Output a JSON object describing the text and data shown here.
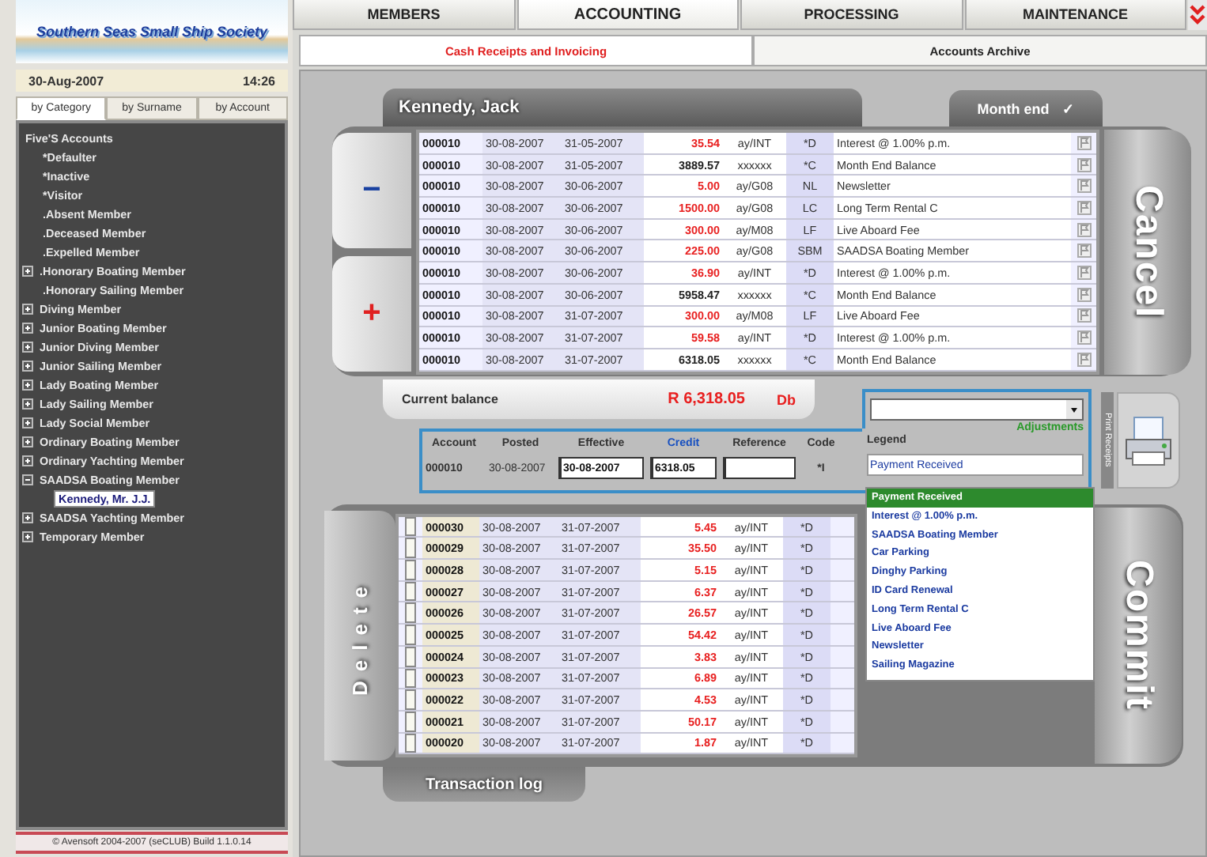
{
  "sidebar": {
    "logo": "Southern Seas Small Ship Society",
    "date": "30-Aug-2007",
    "time": "14:26",
    "tabs": [
      {
        "label": "by Category",
        "selected": true
      },
      {
        "label": "by Surname",
        "selected": false
      },
      {
        "label": "by Account",
        "selected": false
      }
    ],
    "tree": {
      "label": "Five'S Accounts",
      "children": [
        {
          "label": "*Defaulter",
          "kind": "leaf",
          "selected": false
        },
        {
          "label": "*Inactive",
          "kind": "leaf",
          "selected": false
        },
        {
          "label": "*Visitor",
          "kind": "leaf",
          "selected": false
        },
        {
          "label": ".Absent Member",
          "kind": "leaf",
          "selected": false
        },
        {
          "label": ".Deceased Member",
          "kind": "leaf",
          "selected": false
        },
        {
          "label": ".Expelled Member",
          "kind": "leaf",
          "selected": false
        },
        {
          "label": ".Honorary Boating Member",
          "kind": "group",
          "expanded": false,
          "selected": false
        },
        {
          "label": ".Honorary Sailing Member",
          "kind": "leaf",
          "selected": false
        },
        {
          "label": "Diving Member",
          "kind": "group",
          "expanded": false,
          "selected": false
        },
        {
          "label": "Junior Boating Member",
          "kind": "group",
          "expanded": false,
          "selected": false
        },
        {
          "label": "Junior Diving Member",
          "kind": "group",
          "expanded": false,
          "selected": false
        },
        {
          "label": "Junior Sailing Member",
          "kind": "group",
          "expanded": false,
          "selected": false
        },
        {
          "label": "Lady Boating Member",
          "kind": "group",
          "expanded": false,
          "selected": false
        },
        {
          "label": "Lady Sailing Member",
          "kind": "group",
          "expanded": false,
          "selected": false
        },
        {
          "label": "Lady Social Member",
          "kind": "group",
          "expanded": false,
          "selected": false
        },
        {
          "label": "Ordinary Boating Member",
          "kind": "group",
          "expanded": false,
          "selected": false
        },
        {
          "label": "Ordinary Yachting Member",
          "kind": "group",
          "expanded": false,
          "selected": false
        },
        {
          "label": "SAADSA Boating Member",
          "kind": "group",
          "expanded": true,
          "selected": false,
          "children": [
            {
              "label": "Kennedy, Mr. J.J.",
              "kind": "leaf",
              "selected": true
            }
          ]
        },
        {
          "label": "SAADSA Yachting Member",
          "kind": "group",
          "expanded": false,
          "selected": false
        },
        {
          "label": "Temporary Member",
          "kind": "group",
          "expanded": false,
          "selected": false
        }
      ]
    },
    "footer": "© Avensoft 2004-2007 (seCLUB) Build 1.1.0.14"
  },
  "tabs": [
    {
      "label": "MEMBERS",
      "selected": false
    },
    {
      "label": "ACCOUNTING",
      "selected": true
    },
    {
      "label": "PROCESSING",
      "selected": false
    },
    {
      "label": "MAINTENANCE",
      "selected": false
    }
  ],
  "subtabs": [
    {
      "label": "Cash Receipts and Invoicing",
      "selected": true
    },
    {
      "label": "Accounts Archive",
      "selected": false
    }
  ],
  "member_name": "Kennedy, Jack",
  "month_end": {
    "label": "Month end",
    "mark": "✓"
  },
  "ledger": {
    "minus": "−",
    "plus": "+",
    "cancel": "Cancel",
    "rows": [
      {
        "account": "000010",
        "posted": "30-08-2007",
        "effective": "31-05-2007",
        "amount": "35.54",
        "debit": true,
        "ref": "ay/INT",
        "code": "*D",
        "legend": "Interest @ 1.00% p.m."
      },
      {
        "account": "000010",
        "posted": "30-08-2007",
        "effective": "31-05-2007",
        "amount": "3889.57",
        "debit": false,
        "ref": "xxxxxx",
        "code": "*C",
        "legend": "Month End Balance"
      },
      {
        "account": "000010",
        "posted": "30-08-2007",
        "effective": "30-06-2007",
        "amount": "5.00",
        "debit": true,
        "ref": "ay/G08",
        "code": "NL",
        "legend": "Newsletter"
      },
      {
        "account": "000010",
        "posted": "30-08-2007",
        "effective": "30-06-2007",
        "amount": "1500.00",
        "debit": true,
        "ref": "ay/G08",
        "code": "LC",
        "legend": "Long Term Rental C"
      },
      {
        "account": "000010",
        "posted": "30-08-2007",
        "effective": "30-06-2007",
        "amount": "300.00",
        "debit": true,
        "ref": "ay/M08",
        "code": "LF",
        "legend": "Live Aboard Fee"
      },
      {
        "account": "000010",
        "posted": "30-08-2007",
        "effective": "30-06-2007",
        "amount": "225.00",
        "debit": true,
        "ref": "ay/G08",
        "code": "SBM",
        "legend": "SAADSA Boating Member"
      },
      {
        "account": "000010",
        "posted": "30-08-2007",
        "effective": "30-06-2007",
        "amount": "36.90",
        "debit": true,
        "ref": "ay/INT",
        "code": "*D",
        "legend": "Interest @ 1.00% p.m."
      },
      {
        "account": "000010",
        "posted": "30-08-2007",
        "effective": "30-06-2007",
        "amount": "5958.47",
        "debit": false,
        "ref": "xxxxxx",
        "code": "*C",
        "legend": "Month End Balance"
      },
      {
        "account": "000010",
        "posted": "30-08-2007",
        "effective": "31-07-2007",
        "amount": "300.00",
        "debit": true,
        "ref": "ay/M08",
        "code": "LF",
        "legend": "Live Aboard Fee"
      },
      {
        "account": "000010",
        "posted": "30-08-2007",
        "effective": "31-07-2007",
        "amount": "59.58",
        "debit": true,
        "ref": "ay/INT",
        "code": "*D",
        "legend": "Interest @ 1.00% p.m."
      },
      {
        "account": "000010",
        "posted": "30-08-2007",
        "effective": "31-07-2007",
        "amount": "6318.05",
        "debit": false,
        "ref": "xxxxxx",
        "code": "*C",
        "legend": "Month End Balance"
      }
    ]
  },
  "balance": {
    "label": "Current balance",
    "amount": "R 6,318.05",
    "side": "Db"
  },
  "adjustment": {
    "type_label": "Adjustments",
    "print_label": "Print Receipts",
    "headers": [
      "Account",
      "Posted",
      "Effective",
      "Credit",
      "Reference",
      "Code",
      "Legend"
    ],
    "account": "000010",
    "posted": "30-08-2007",
    "effective": "30-08-2007",
    "credit": "6318.05",
    "code": "*I",
    "legend": "Payment Received",
    "options": [
      {
        "label": "Payment Received",
        "selected": true
      },
      {
        "label": "Interest @ 1.00% p.m.",
        "selected": false
      },
      {
        "label": "SAADSA Boating Member",
        "selected": false
      },
      {
        "label": "Car Parking",
        "selected": false
      },
      {
        "label": "Dinghy Parking",
        "selected": false
      },
      {
        "label": "ID Card Renewal",
        "selected": false
      },
      {
        "label": "Long Term Rental C",
        "selected": false
      },
      {
        "label": "Live Aboard Fee",
        "selected": false
      },
      {
        "label": "Newsletter",
        "selected": false
      },
      {
        "label": "Sailing Magazine",
        "selected": false
      }
    ]
  },
  "pending": {
    "delete": "Delete",
    "commit": "Commit",
    "log": "Transaction log",
    "rows": [
      {
        "checked": false,
        "account": "000030",
        "posted": "30-08-2007",
        "effective": "31-07-2007",
        "amount": "5.45",
        "ref": "ay/INT",
        "code": "*D"
      },
      {
        "checked": false,
        "account": "000029",
        "posted": "30-08-2007",
        "effective": "31-07-2007",
        "amount": "35.50",
        "ref": "ay/INT",
        "code": "*D"
      },
      {
        "checked": false,
        "account": "000028",
        "posted": "30-08-2007",
        "effective": "31-07-2007",
        "amount": "5.15",
        "ref": "ay/INT",
        "code": "*D"
      },
      {
        "checked": false,
        "account": "000027",
        "posted": "30-08-2007",
        "effective": "31-07-2007",
        "amount": "6.37",
        "ref": "ay/INT",
        "code": "*D"
      },
      {
        "checked": false,
        "account": "000026",
        "posted": "30-08-2007",
        "effective": "31-07-2007",
        "amount": "26.57",
        "ref": "ay/INT",
        "code": "*D"
      },
      {
        "checked": false,
        "account": "000025",
        "posted": "30-08-2007",
        "effective": "31-07-2007",
        "amount": "54.42",
        "ref": "ay/INT",
        "code": "*D"
      },
      {
        "checked": false,
        "account": "000024",
        "posted": "30-08-2007",
        "effective": "31-07-2007",
        "amount": "3.83",
        "ref": "ay/INT",
        "code": "*D"
      },
      {
        "checked": false,
        "account": "000023",
        "posted": "30-08-2007",
        "effective": "31-07-2007",
        "amount": "6.89",
        "ref": "ay/INT",
        "code": "*D"
      },
      {
        "checked": false,
        "account": "000022",
        "posted": "30-08-2007",
        "effective": "31-07-2007",
        "amount": "4.53",
        "ref": "ay/INT",
        "code": "*D"
      },
      {
        "checked": false,
        "account": "000021",
        "posted": "30-08-2007",
        "effective": "31-07-2007",
        "amount": "50.17",
        "ref": "ay/INT",
        "code": "*D"
      },
      {
        "checked": false,
        "account": "000020",
        "posted": "30-08-2007",
        "effective": "31-07-2007",
        "amount": "1.87",
        "ref": "ay/INT",
        "code": "*D"
      }
    ]
  }
}
